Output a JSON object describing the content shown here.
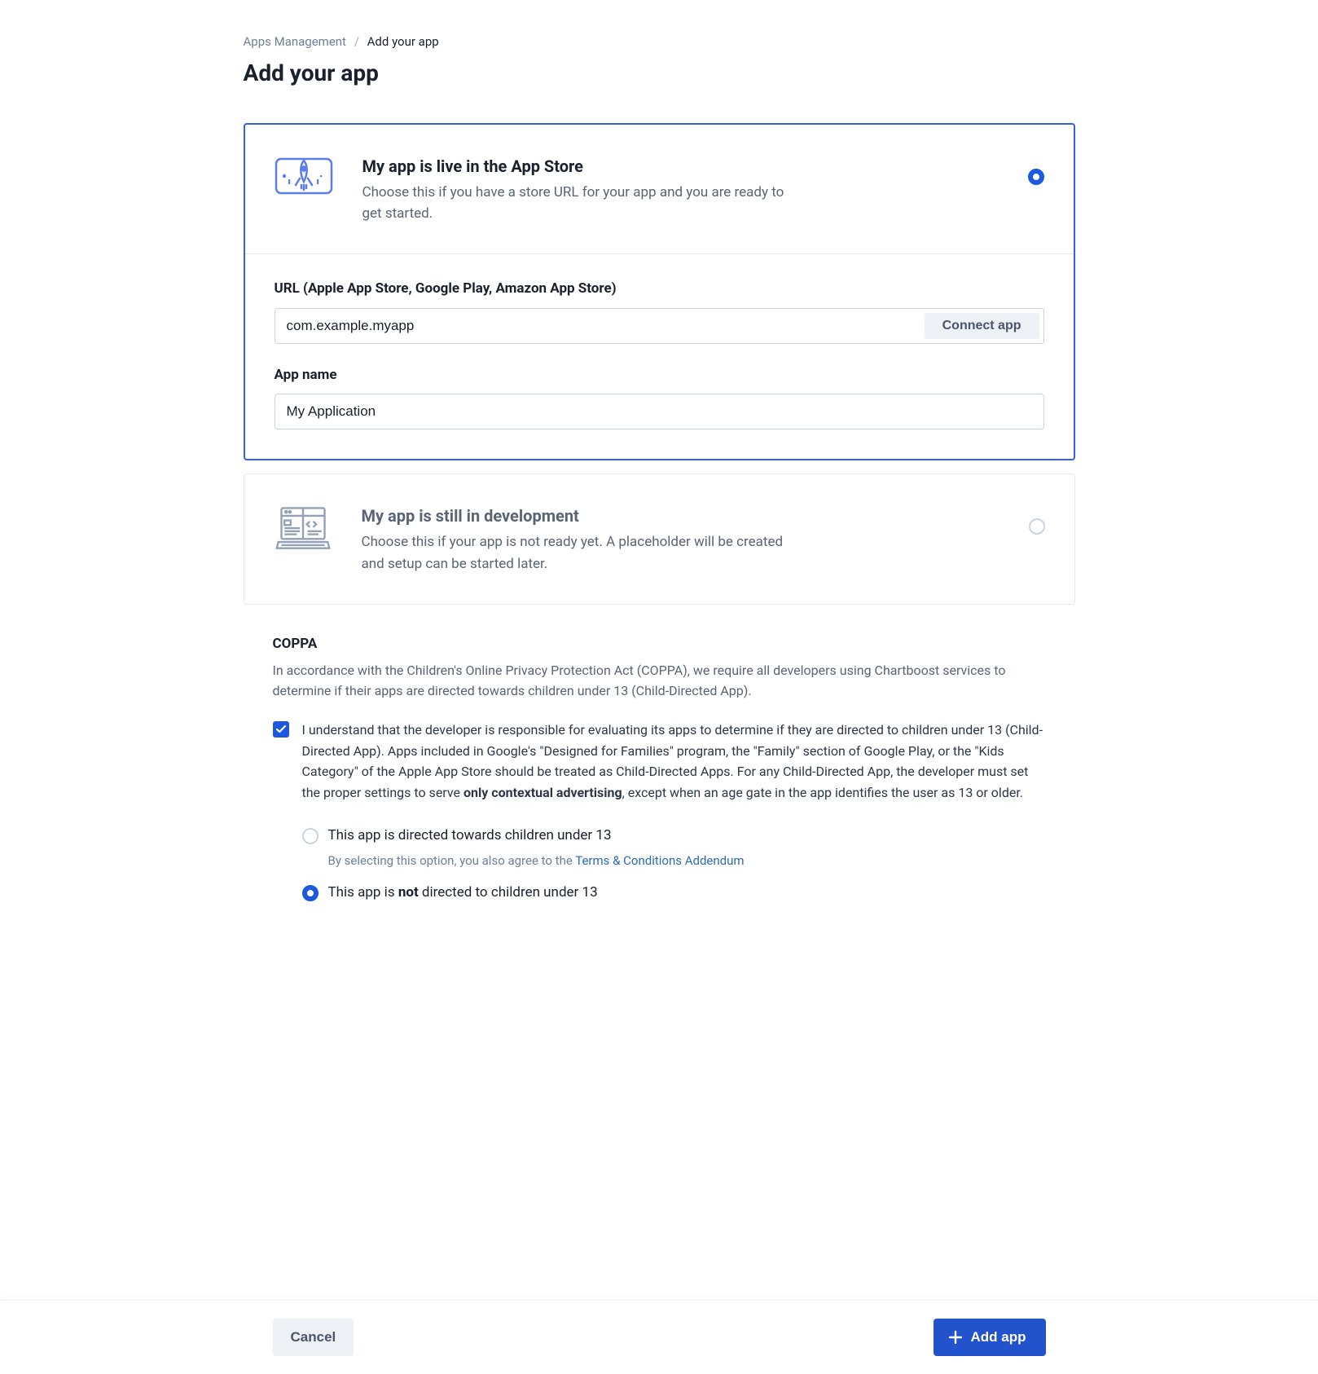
{
  "breadcrumb": {
    "parent": "Apps Management",
    "current": "Add your app"
  },
  "page_title": "Add your app",
  "options": {
    "live": {
      "title": "My app is live in the App Store",
      "desc": "Choose this if you have a store URL for your app and you are ready to get started.",
      "selected": true,
      "url_label": "URL (Apple App Store, Google Play, Amazon App Store)",
      "url_value": "com.example.myapp",
      "connect_label": "Connect app",
      "name_label": "App name",
      "name_value": "My Application"
    },
    "dev": {
      "title": "My app is still in development",
      "desc": "Choose this if your app is not ready yet. A placeholder will be created and setup can be started later.",
      "selected": false
    }
  },
  "coppa": {
    "title": "COPPA",
    "intro": "In accordance with the Children's Online Privacy Protection Act (COPPA), we require all developers using Chartboost services to determine if their apps are directed towards children under 13 (Child-Directed App).",
    "ack_pre": "I understand that the developer is responsible for evaluating its apps to determine if they are directed to children under 13 (Child-Directed App). Apps included in Google's \"Designed for Families\" program, the \"Family\" section of Google Play, or the \"Kids Category\" of the Apple App Store should be treated as Child-Directed Apps. For any Child-Directed App, the developer must set the proper settings to serve ",
    "ack_bold": "only contextual advertising",
    "ack_post": ", except when an age gate in the app identifies the user as 13 or older.",
    "ack_checked": true,
    "opt_directed": "This app is directed towards children under 13",
    "opt_directed_sub_pre": "By selecting this option, you also agree to the ",
    "opt_directed_sub_link": "Terms & Conditions Addendum",
    "opt_not_pre": "This app is ",
    "opt_not_bold": "not",
    "opt_not_post": " directed to children under 13",
    "selected": "not"
  },
  "footer": {
    "cancel": "Cancel",
    "add": "Add app"
  }
}
